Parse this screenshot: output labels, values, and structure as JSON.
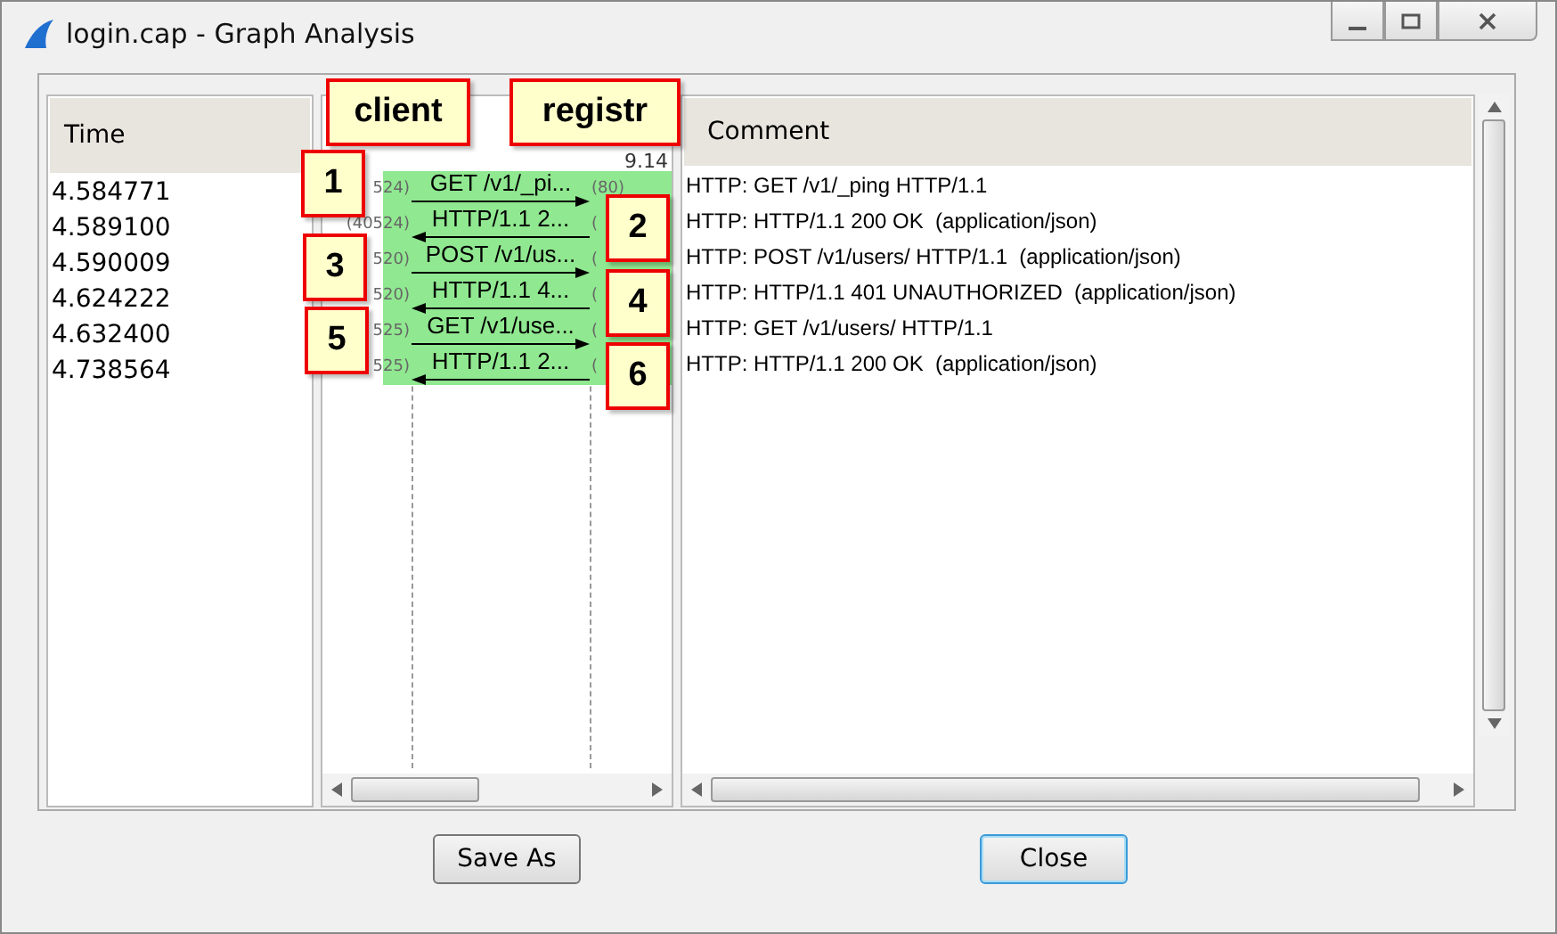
{
  "window": {
    "title": "login.cap - Graph Analysis"
  },
  "time_pane": {
    "header": "Time"
  },
  "graph_pane": {
    "host_header": "9.14"
  },
  "flows": [
    {
      "time": "4.584771",
      "label": "GET /v1/_pi...",
      "kind": "request",
      "src_port": "524)",
      "dst_port": "(80)",
      "comment": "HTTP: GET /v1/_ping HTTP/1.1"
    },
    {
      "time": "4.589100",
      "label": "HTTP/1.1 2...",
      "kind": "response",
      "src_port": "(40524)",
      "dst_port": "(",
      "comment": "HTTP: HTTP/1.1 200 OK  (application/json)"
    },
    {
      "time": "4.590009",
      "label": "POST /v1/us...",
      "kind": "request",
      "src_port": "520)",
      "dst_port": "(",
      "comment": "HTTP: POST /v1/users/ HTTP/1.1  (application/json)"
    },
    {
      "time": "4.624222",
      "label": "HTTP/1.1 4...",
      "kind": "response",
      "src_port": "520)",
      "dst_port": "(",
      "comment": "HTTP: HTTP/1.1 401 UNAUTHORIZED  (application/json)"
    },
    {
      "time": "4.632400",
      "label": "GET /v1/use...",
      "kind": "request",
      "src_port": "525)",
      "dst_port": "(",
      "comment": "HTTP: GET /v1/users/ HTTP/1.1"
    },
    {
      "time": "4.738564",
      "label": "HTTP/1.1 2...",
      "kind": "response",
      "src_port": "525)",
      "dst_port": "(",
      "comment": "HTTP: HTTP/1.1 200 OK  (application/json)"
    }
  ],
  "comment_pane": {
    "header": "Comment"
  },
  "annotations": [
    {
      "text": "client",
      "kind": "host"
    },
    {
      "text": "registr",
      "kind": "host"
    },
    {
      "text": "1",
      "kind": "step"
    },
    {
      "text": "2",
      "kind": "step"
    },
    {
      "text": "3",
      "kind": "step"
    },
    {
      "text": "4",
      "kind": "step"
    },
    {
      "text": "5",
      "kind": "step"
    },
    {
      "text": "6",
      "kind": "step"
    }
  ],
  "buttons": [
    {
      "label": "Save As",
      "default": false
    },
    {
      "label": "Close",
      "default": true
    }
  ]
}
